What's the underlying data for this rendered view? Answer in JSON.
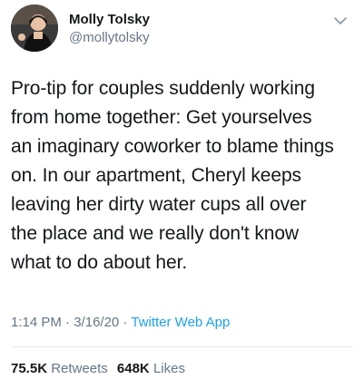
{
  "author": {
    "display_name": "Molly Tolsky",
    "handle": "@mollytolsky",
    "avatar_icon": "profile-photo"
  },
  "menu": {
    "icon": "chevron-down-icon"
  },
  "tweet": {
    "lines": [
      "Pro-tip for couples suddenly working",
      "from home together: Get yourselves",
      "an imaginary coworker to blame things",
      "on. In our apartment, Cheryl keeps",
      "leaving her dirty water cups all over",
      "the place and we really don't know",
      "what to do about her."
    ]
  },
  "meta": {
    "time": "1:14 PM",
    "separator1": "·",
    "date": "3/16/20",
    "separator2": "·",
    "source": "Twitter Web App"
  },
  "stats": {
    "retweets_count": "75.5K",
    "retweets_label": "Retweets",
    "likes_count": "648K",
    "likes_label": "Likes"
  },
  "colors": {
    "text": "#14171a",
    "secondary": "#657786",
    "link": "#1da1f2",
    "divider": "#e1e8ed"
  }
}
